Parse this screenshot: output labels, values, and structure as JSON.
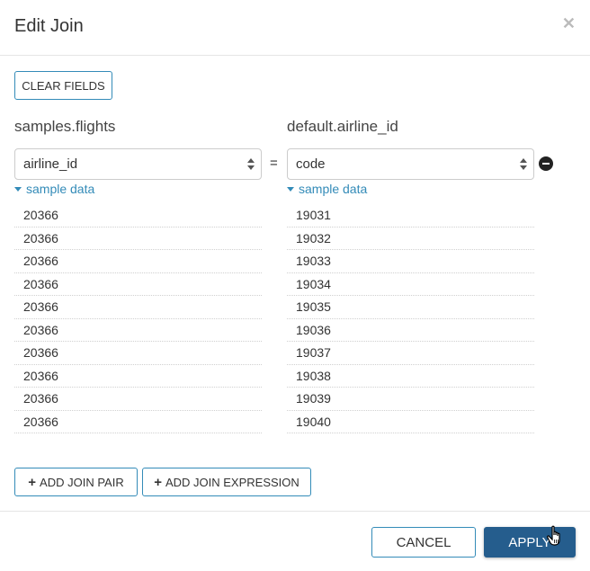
{
  "dialog": {
    "title": "Edit Join",
    "close_icon": "times-icon"
  },
  "toolbar": {
    "clear_fields_label": "CLEAR FIELDS"
  },
  "join": {
    "left": {
      "table": "samples.flights",
      "selected_column": "airline_id",
      "sample_toggle_label": "sample data",
      "sample_values": [
        "20366",
        "20366",
        "20366",
        "20366",
        "20366",
        "20366",
        "20366",
        "20366",
        "20366",
        "20366"
      ]
    },
    "operator": "=",
    "right": {
      "table": "default.airline_id",
      "selected_column": "code",
      "sample_toggle_label": "sample data",
      "sample_values": [
        "19031",
        "19032",
        "19033",
        "19034",
        "19035",
        "19036",
        "19037",
        "19038",
        "19039",
        "19040"
      ]
    },
    "remove_icon": "minus-circle-icon"
  },
  "actions": {
    "add_join_pair_label": "ADD JOIN PAIR",
    "add_join_expression_label": "ADD JOIN EXPRESSION",
    "plus_icon": "+"
  },
  "footer": {
    "cancel_label": "CANCEL",
    "apply_label": "APPLY"
  },
  "colors": {
    "accent": "#338bb8",
    "primary_button": "#255d8d"
  }
}
